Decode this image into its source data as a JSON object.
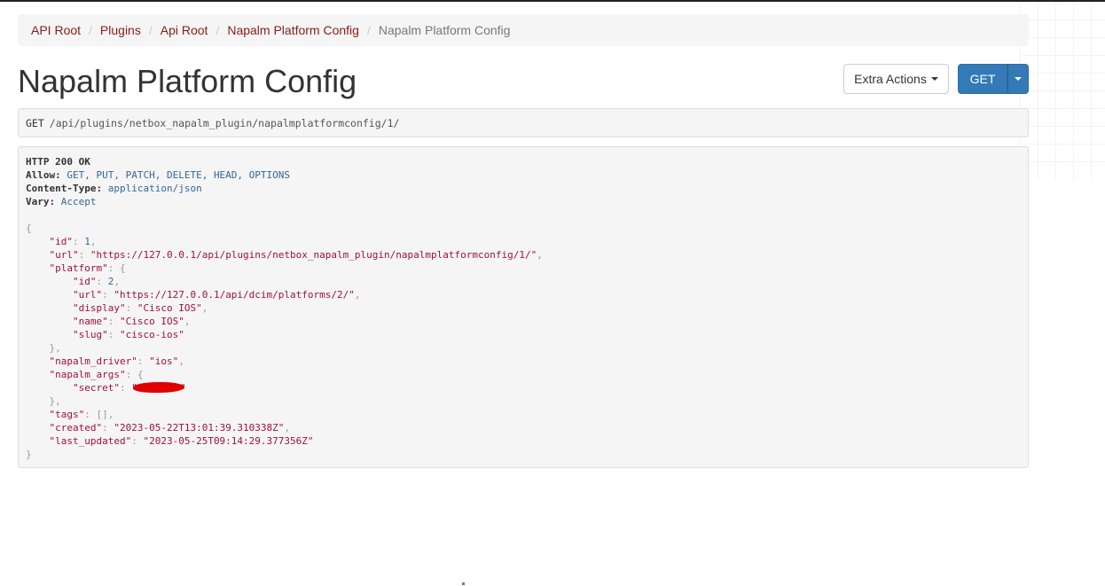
{
  "breadcrumb": {
    "items": [
      "API Root",
      "Plugins",
      "Api Root",
      "Napalm Platform Config"
    ],
    "active": "Napalm Platform Config",
    "separator": "/"
  },
  "page_title": "Napalm Platform Config",
  "buttons": {
    "extra_actions": "Extra Actions",
    "get": "GET"
  },
  "request": {
    "method": "GET",
    "path": "/api/plugins/netbox_napalm_plugin/napalmplatformconfig/1/"
  },
  "response": {
    "status": "HTTP 200 OK",
    "headers": [
      {
        "name": "Allow",
        "value": "GET, PUT, PATCH, DELETE, HEAD, OPTIONS"
      },
      {
        "name": "Content-Type",
        "value": "application/json"
      },
      {
        "name": "Vary",
        "value": "Accept"
      }
    ],
    "body": {
      "id": "1",
      "url": "\"https://127.0.0.1/api/plugins/netbox_napalm_plugin/napalmplatformconfig/1/\"",
      "platform": {
        "id": "2",
        "url": "\"https://127.0.0.1/api/dcim/platforms/2/\"",
        "display": "\"Cisco IOS\"",
        "name": "\"Cisco IOS\"",
        "slug": "\"cisco-ios\""
      },
      "napalm_driver": "\"ios\"",
      "napalm_args": {
        "secret_open": "\"",
        "secret_close": "\""
      },
      "tags": "[]",
      "created": "\"2023-05-22T13:01:39.310338Z\"",
      "last_updated": "\"2023-05-25T09:14:29.377356Z\""
    },
    "keys": {
      "id": "\"id\"",
      "url": "\"url\"",
      "platform": "\"platform\"",
      "display": "\"display\"",
      "name": "\"name\"",
      "slug": "\"slug\"",
      "napalm_driver": "\"napalm_driver\"",
      "napalm_args": "\"napalm_args\"",
      "secret": "\"secret\"",
      "tags": "\"tags\"",
      "created": "\"created\"",
      "last_updated": "\"last_updated\""
    }
  },
  "colors": {
    "link": "#8b1a1a",
    "primary": "#337ab7",
    "json_string": "#a0103c",
    "json_number": "#336699",
    "redaction": "#e00000"
  }
}
